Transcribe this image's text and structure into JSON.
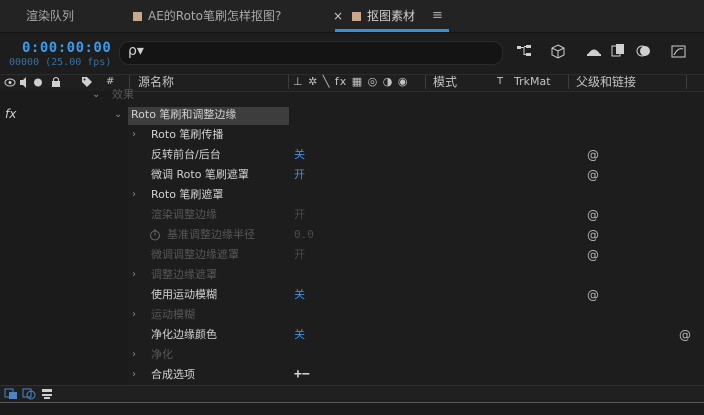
{
  "tabs": [
    {
      "label": "渲染队列"
    },
    {
      "label": "AE的Roto笔刷怎样抠图?"
    },
    {
      "label": "抠图素材"
    }
  ],
  "tab_close_glyph": "×",
  "tab_menu_glyph": "≡",
  "timecode": "0:00:00:00",
  "frame_info": "00000 (25.00 fps)",
  "search": {
    "icon_glyph": "ρ▾",
    "placeholder": ""
  },
  "toolbar_icons": [
    "comp-flowchart-icon",
    "solo-icon",
    "draft3d-icon",
    "frame-blend-icon",
    "motion-blur-icon",
    "graph-editor-icon"
  ],
  "columns": {
    "switches_glyphs": "◉◐ ▪ 🔒",
    "label_glyph": "🏷",
    "number": "#",
    "source_name": "源名称",
    "layer_switches": "⊥ ✲ ╲ fx ▦ ◎ ◑ ◉",
    "mode": "模式",
    "t": "T",
    "trkmat": "TrkMat",
    "parent": "父级和链接"
  },
  "effects_label": "效果",
  "fx_label": "fx",
  "effect_name": "Roto 笔刷和调整边缘",
  "properties": [
    {
      "label": "Roto 笔刷传播",
      "expander": "›",
      "value": "",
      "dim": false,
      "spiral": false
    },
    {
      "label": "反转前台/后台",
      "expander": "",
      "value": "关",
      "dim": false,
      "spiral": true
    },
    {
      "label": "微调 Roto 笔刷遮罩",
      "expander": "",
      "value": "开",
      "dim": false,
      "spiral": true
    },
    {
      "label": "Roto 笔刷遮罩",
      "expander": "›",
      "value": "",
      "dim": false,
      "spiral": false
    },
    {
      "label": "渲染调整边缘",
      "expander": "",
      "value": "开",
      "dim": true,
      "spiral": true
    },
    {
      "label": "基准调整边缘半径",
      "expander": "",
      "value": "0.0",
      "dim": true,
      "spiral": true,
      "stopwatch": true
    },
    {
      "label": "微调调整边缘遮罩",
      "expander": "",
      "value": "开",
      "dim": true,
      "spiral": true
    },
    {
      "label": "调整边缘遮罩",
      "expander": "›",
      "value": "",
      "dim": true,
      "spiral": false
    },
    {
      "label": "使用运动模糊",
      "expander": "",
      "value": "关",
      "dim": false,
      "spiral": true
    },
    {
      "label": "运动模糊",
      "expander": "›",
      "value": "",
      "dim": true,
      "spiral": false
    },
    {
      "label": "净化边缘颜色",
      "expander": "",
      "value": "关",
      "dim": false,
      "spiral": true
    },
    {
      "label": "净化",
      "expander": "›",
      "value": "",
      "dim": true,
      "spiral": false
    },
    {
      "label": "合成选项",
      "expander": "›",
      "value": "+−",
      "dim": false,
      "spiral": false
    }
  ],
  "spiral_glyph": "@",
  "colors": {
    "accent": "#3d9ae8",
    "value_blue": "#3d8fe0",
    "panel_bg": "#1d1d1d"
  }
}
